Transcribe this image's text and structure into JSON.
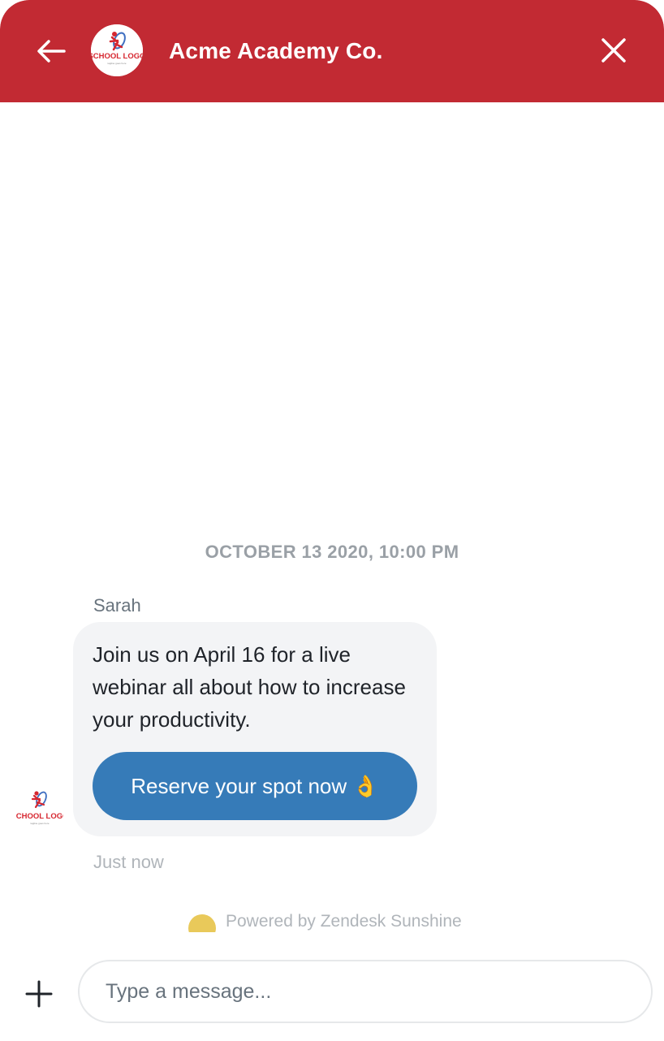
{
  "header": {
    "title": "Acme Academy Co.",
    "logo_text": "SCHOOL LOGO",
    "logo_tagline": "tagline goes here",
    "back_icon": "arrow-left-icon",
    "close_icon": "close-icon"
  },
  "conversation": {
    "timestamp": "OCTOBER 13 2020, 10:00 PM",
    "messages": [
      {
        "sender": "Sarah",
        "text": "Join us on April 16 for a live webinar all about how to increase your productivity.",
        "action_label": "Reserve your spot now 👌",
        "time": "Just now"
      }
    ]
  },
  "footer": {
    "powered_by": "Powered by Zendesk Sunshine"
  },
  "composer": {
    "placeholder": "Type a message...",
    "value": "",
    "add_icon": "plus-icon"
  },
  "colors": {
    "brand": "#c22a33",
    "action_button": "#367bb8",
    "bubble": "#f3f4f6",
    "sun": "#e9c95a"
  }
}
